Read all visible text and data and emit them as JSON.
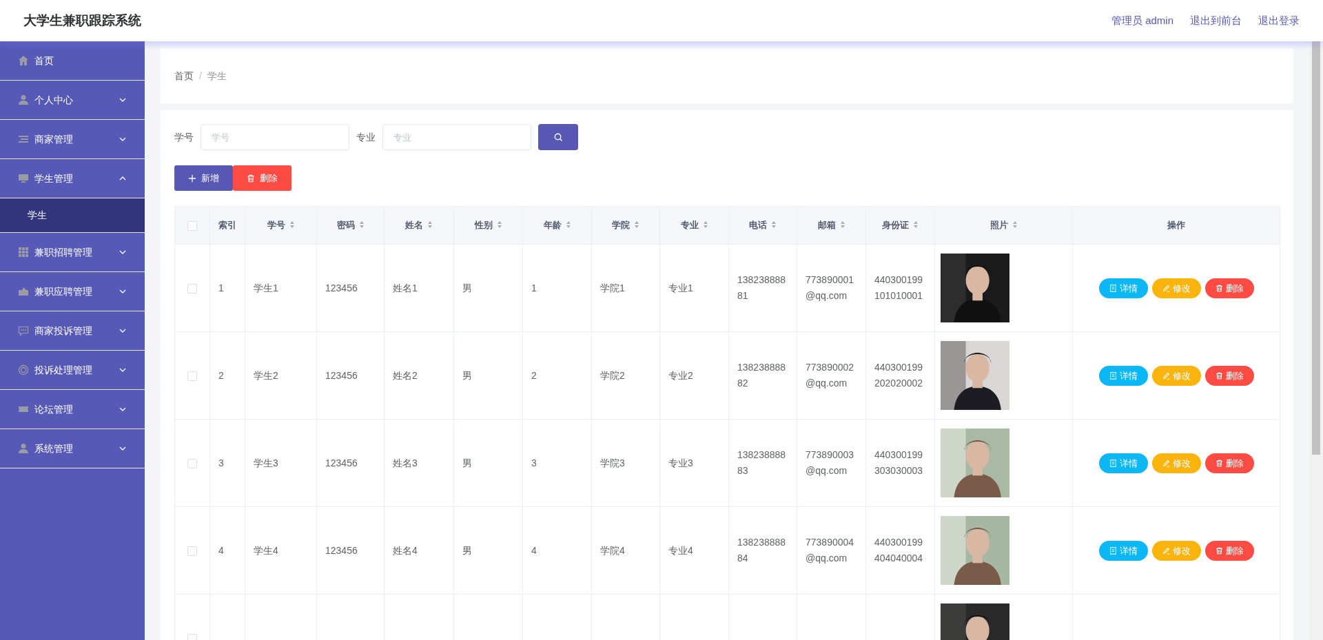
{
  "header": {
    "title": "大学生兼职跟踪系统",
    "links": [
      "管理员 admin",
      "退出到前台",
      "退出登录"
    ]
  },
  "sidebar": {
    "items": [
      {
        "label": "首页",
        "kind": "link"
      },
      {
        "label": "个人中心",
        "kind": "menu",
        "expanded": false
      },
      {
        "label": "商家管理",
        "kind": "menu",
        "expanded": false
      },
      {
        "label": "学生管理",
        "kind": "menu",
        "expanded": true,
        "children": [
          {
            "label": "学生",
            "selected": true
          }
        ]
      },
      {
        "label": "兼职招聘管理",
        "kind": "menu",
        "expanded": false
      },
      {
        "label": "兼职应聘管理",
        "kind": "menu",
        "expanded": false
      },
      {
        "label": "商家投诉管理",
        "kind": "menu",
        "expanded": false
      },
      {
        "label": "投诉处理管理",
        "kind": "menu",
        "expanded": false
      },
      {
        "label": "论坛管理",
        "kind": "menu",
        "expanded": false
      },
      {
        "label": "系统管理",
        "kind": "menu",
        "expanded": false
      }
    ]
  },
  "breadcrumb": [
    "首页",
    "学生"
  ],
  "breadcrumb_separator": "/",
  "search": {
    "fields": [
      {
        "label": "学号",
        "placeholder": "学号"
      },
      {
        "label": "专业",
        "placeholder": "专业"
      }
    ]
  },
  "actions": [
    {
      "label": "新增",
      "kind": "add"
    },
    {
      "label": "删除",
      "kind": "delete"
    }
  ],
  "table": {
    "select_all_checked": false,
    "columns": [
      {
        "label": "索引",
        "sortable": false
      },
      {
        "label": "学号",
        "sortable": true
      },
      {
        "label": "密码",
        "sortable": true
      },
      {
        "label": "姓名",
        "sortable": true
      },
      {
        "label": "性别",
        "sortable": true
      },
      {
        "label": "年龄",
        "sortable": true
      },
      {
        "label": "学院",
        "sortable": true
      },
      {
        "label": "专业",
        "sortable": true
      },
      {
        "label": "电话",
        "sortable": true
      },
      {
        "label": "邮箱",
        "sortable": true
      },
      {
        "label": "身份证",
        "sortable": true
      },
      {
        "label": "照片",
        "sortable": true
      },
      {
        "label": "操作",
        "sortable": false
      }
    ],
    "rows": [
      {
        "checked": false,
        "cells": [
          "1",
          "学生1",
          "123456",
          "姓名1",
          "男",
          "1",
          "学院1",
          "专业1",
          "13823888881",
          "773890001@qq.com",
          "440300199101010001"
        ],
        "actions": [
          {
            "label": "详情",
            "kind": "detail"
          },
          {
            "label": "修改",
            "kind": "edit"
          },
          {
            "label": "删除",
            "kind": "delete"
          }
        ]
      },
      {
        "checked": false,
        "cells": [
          "2",
          "学生2",
          "123456",
          "姓名2",
          "男",
          "2",
          "学院2",
          "专业2",
          "13823888882",
          "773890002@qq.com",
          "440300199202020002"
        ],
        "actions": [
          {
            "label": "详情",
            "kind": "detail"
          },
          {
            "label": "修改",
            "kind": "edit"
          },
          {
            "label": "删除",
            "kind": "delete"
          }
        ]
      },
      {
        "checked": false,
        "cells": [
          "3",
          "学生3",
          "123456",
          "姓名3",
          "男",
          "3",
          "学院3",
          "专业3",
          "13823888883",
          "773890003@qq.com",
          "440300199303030003"
        ],
        "actions": [
          {
            "label": "详情",
            "kind": "detail"
          },
          {
            "label": "修改",
            "kind": "edit"
          },
          {
            "label": "删除",
            "kind": "delete"
          }
        ]
      },
      {
        "checked": false,
        "cells": [
          "4",
          "学生4",
          "123456",
          "姓名4",
          "男",
          "4",
          "学院4",
          "专业4",
          "13823888884",
          "773890004@qq.com",
          "440300199404040004"
        ],
        "actions": [
          {
            "label": "详情",
            "kind": "detail"
          },
          {
            "label": "修改",
            "kind": "edit"
          },
          {
            "label": "删除",
            "kind": "delete"
          }
        ]
      },
      {
        "checked": false
      }
    ]
  }
}
